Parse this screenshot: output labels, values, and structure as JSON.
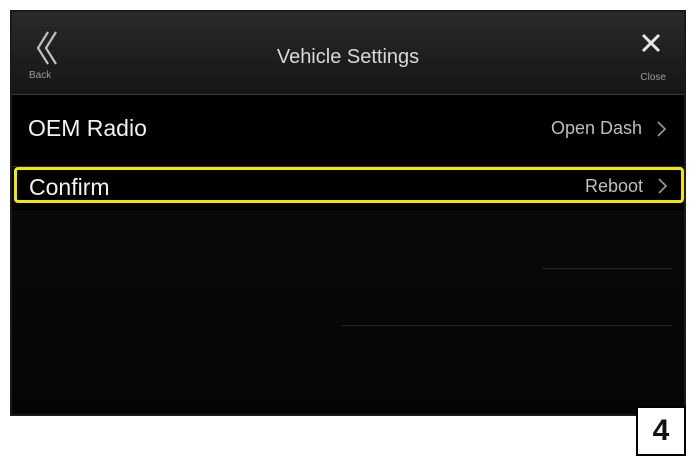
{
  "header": {
    "title": "Vehicle Settings",
    "back_label": "Back",
    "close_label": "Close"
  },
  "settings": [
    {
      "label": "OEM Radio",
      "value": "Open Dash"
    },
    {
      "label": "Confirm",
      "value": "Reboot",
      "highlighted": true
    }
  ],
  "page_number": "4",
  "colors": {
    "highlight": "#f0e800",
    "background": "#000000"
  }
}
